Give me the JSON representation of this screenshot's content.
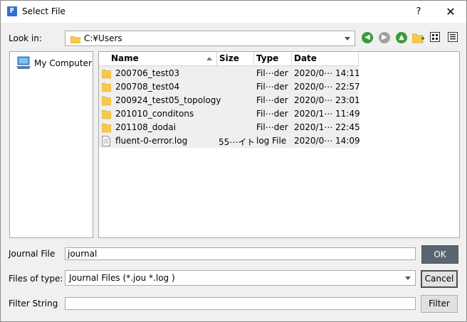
{
  "window": {
    "title": "Select File",
    "app_icon_letter": "F",
    "help_label": "?",
    "close_label": "✕"
  },
  "lookin": {
    "label": "Look in:",
    "value": "C:¥Users"
  },
  "toolbar": {
    "icons": [
      "back-icon",
      "forward-icon",
      "up-icon",
      "new-folder-icon",
      "list-view-icon",
      "detail-view-icon"
    ]
  },
  "sidebar": {
    "items": [
      {
        "label": "My Computer",
        "icon": "computer-icon"
      }
    ]
  },
  "filelist": {
    "columns": [
      "Name",
      "Size",
      "Type",
      "Date Modified"
    ],
    "sort_column": "Name",
    "rows": [
      {
        "icon": "folder-icon",
        "name": "200706_test03",
        "size": "",
        "type": "Fil⋯der",
        "date": "2020/0⋯ 14:11"
      },
      {
        "icon": "folder-icon",
        "name": "200708_test04",
        "size": "",
        "type": "Fil⋯der",
        "date": "2020/0⋯ 22:57"
      },
      {
        "icon": "folder-icon",
        "name": "200924_test05_topology",
        "size": "",
        "type": "Fil⋯der",
        "date": "2020/0⋯ 23:01"
      },
      {
        "icon": "folder-icon",
        "name": "201010_conditons",
        "size": "",
        "type": "Fil⋯der",
        "date": "2020/1⋯ 11:49"
      },
      {
        "icon": "folder-icon",
        "name": "201108_dodai",
        "size": "",
        "type": "Fil⋯der",
        "date": "2020/1⋯ 22:45"
      },
      {
        "icon": "file-icon",
        "name": "fluent-0-error.log",
        "size": "55⋯イト",
        "type": "log File",
        "date": "2020/0⋯ 14:09"
      }
    ]
  },
  "form": {
    "journal_label": "Journal File",
    "journal_value": "journal",
    "types_label": "Files of type:",
    "types_value": "Journal Files (*.jou *.log )",
    "filter_label": "Filter String",
    "filter_value": ""
  },
  "buttons": {
    "ok": "OK",
    "cancel": "Cancel",
    "filter": "Filter"
  },
  "colors": {
    "ok_button": "#5a6572",
    "folder": "#f6c94b",
    "nav_green": "#3a9a3a",
    "nav_gray": "#a0a0a0"
  }
}
